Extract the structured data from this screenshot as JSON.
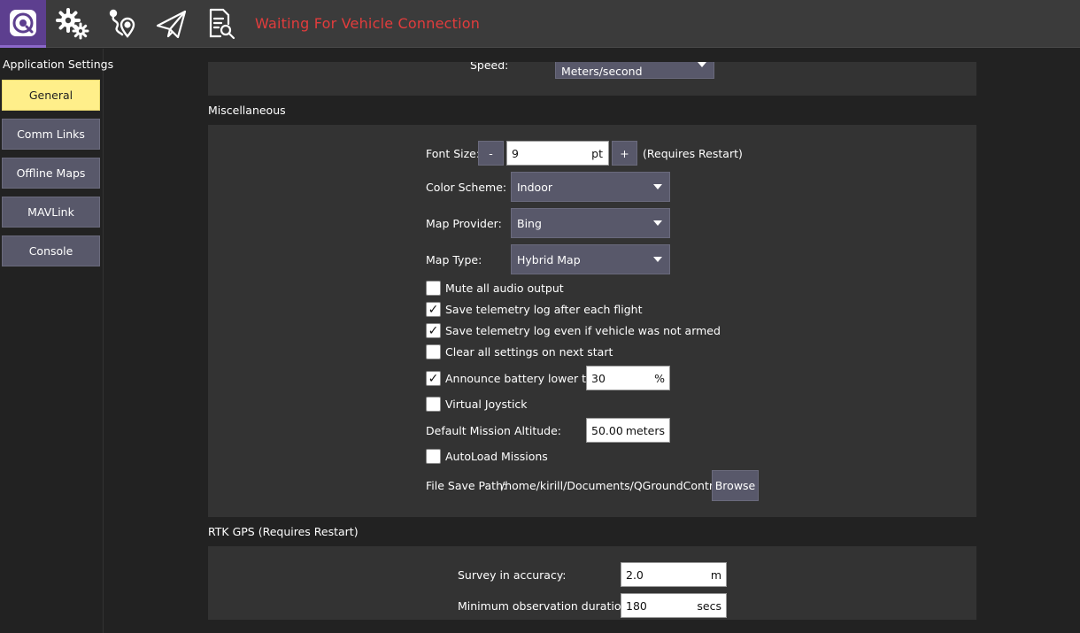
{
  "toolbar": {
    "icons": [
      "qgc-logo-icon",
      "gears-icon",
      "plan-route-icon",
      "paper-plane-icon",
      "analyze-log-icon"
    ],
    "status": "Waiting For Vehicle Connection",
    "status_color": "#e23c3c"
  },
  "sidebar": {
    "title": "Application Settings",
    "items": [
      {
        "label": "General",
        "active": true
      },
      {
        "label": "Comm Links"
      },
      {
        "label": "Offline Maps"
      },
      {
        "label": "MAVLink"
      },
      {
        "label": "Console"
      }
    ],
    "active_color": "#ffef8a"
  },
  "units": {
    "speed_label": "Speed:",
    "speed_value": "Meters/second"
  },
  "misc": {
    "title": "Miscellaneous",
    "font_size_label": "Font Size:",
    "font_minus": "-",
    "font_value": "9",
    "font_unit": "pt",
    "font_plus": "+",
    "font_note": "(Requires Restart)",
    "color_scheme_label": "Color Scheme:",
    "color_scheme_value": "Indoor",
    "map_provider_label": "Map Provider:",
    "map_provider_value": "Bing",
    "map_type_label": "Map Type:",
    "map_type_value": "Hybrid Map",
    "checkboxes": [
      {
        "label": "Mute all audio output",
        "checked": false
      },
      {
        "label": "Save telemetry log after each flight",
        "checked": true
      },
      {
        "label": "Save telemetry log even if vehicle was not armed",
        "checked": true
      },
      {
        "label": "Clear all settings on next start",
        "checked": false
      },
      {
        "label": "Announce battery lower than",
        "checked": true
      },
      {
        "label": "Virtual Joystick",
        "checked": false
      }
    ],
    "battery_value": "30",
    "battery_unit": "%",
    "check_mark": "✓",
    "altitude_label": "Default Mission Altitude:",
    "altitude_value": "50.00",
    "altitude_unit": "meters",
    "autoload": {
      "label": "AutoLoad Missions",
      "checked": false
    },
    "file_path_label": "File Save Path:",
    "file_path_value": "/home/kirill/Documents/QGroundControl",
    "browse_label": "Browse"
  },
  "rtk": {
    "title": "RTK GPS (Requires Restart)",
    "survey_label": "Survey in accuracy:",
    "survey_value": "2.0",
    "survey_unit": "m",
    "min_obs_label": "Minimum observation duration:",
    "min_obs_value": "180",
    "min_obs_unit": "secs"
  }
}
